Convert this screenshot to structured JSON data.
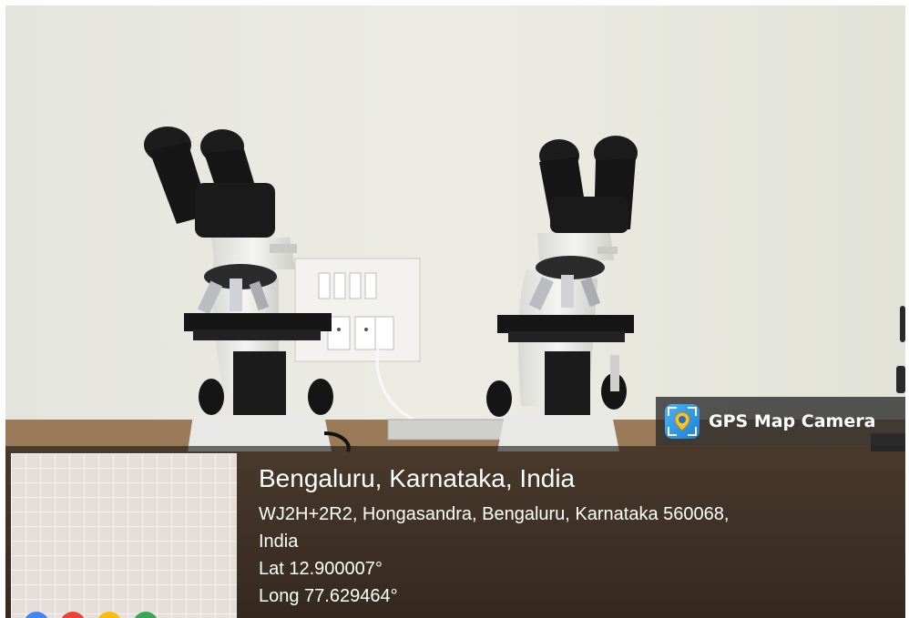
{
  "overlay": {
    "app_name": "GPS Map Camera",
    "logo_icon": "gps-map-camera-logo-icon",
    "location_title": "Bengaluru, Karnataka, India",
    "address_line1": "WJ2H+2R2, Hongasandra, Bengaluru, Karnataka 560068,",
    "address_line2": "India",
    "latitude": "Lat 12.900007°",
    "longitude": "Long 77.629464°"
  },
  "colors": {
    "wall": "#e6e6dd",
    "table_wood": "#7a5a3c",
    "microscope_body": "#ededed",
    "overlay_bg": "#282828",
    "logo_blue": "#3aa2ef",
    "pin_yellow": "#f2c230"
  }
}
